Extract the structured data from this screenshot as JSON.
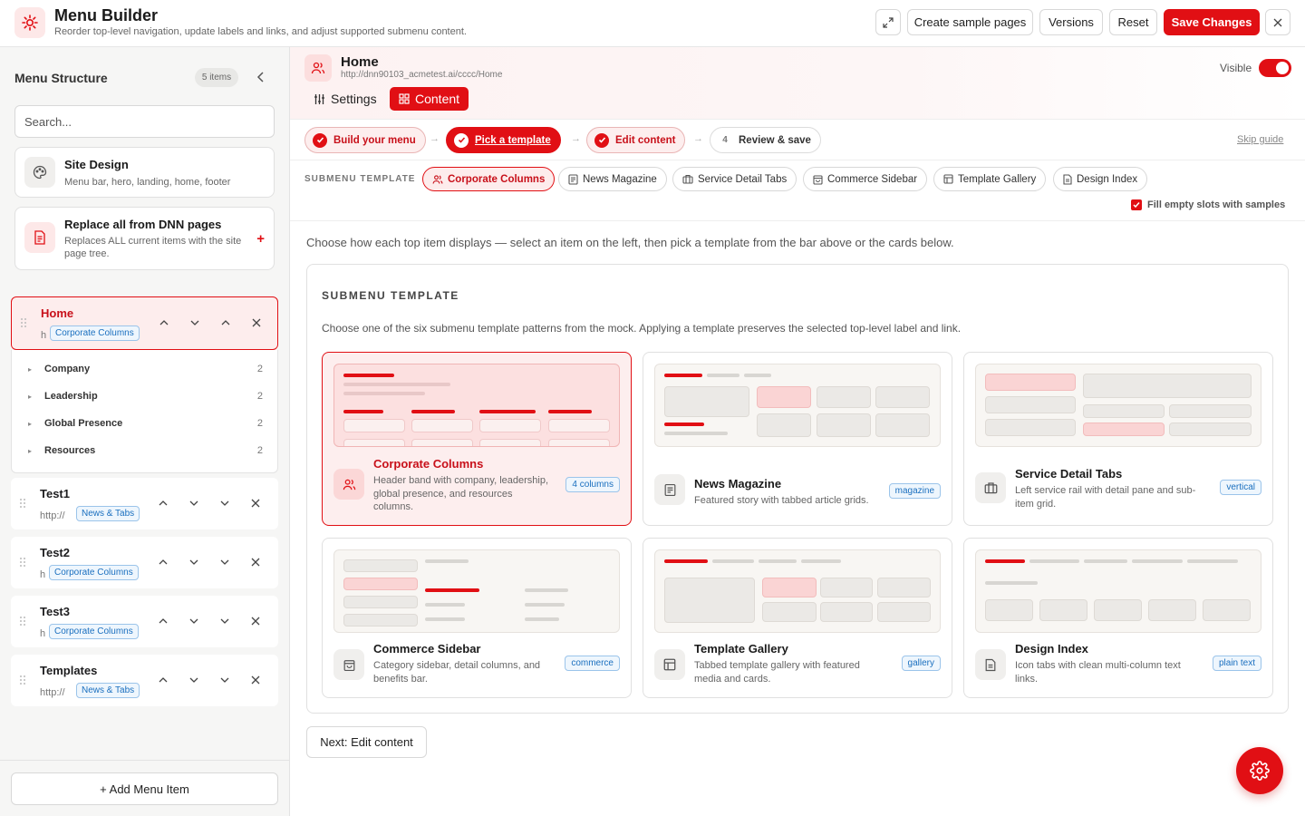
{
  "app": {
    "title": "Menu Builder",
    "subtitle": "Reorder top-level navigation, update labels and links, and adjust supported submenu content."
  },
  "toolbar": {
    "create_sample": "Create sample pages",
    "versions": "Versions",
    "reset": "Reset",
    "save": "Save Changes"
  },
  "sidebar": {
    "title": "Menu Structure",
    "count": "5 items",
    "search_placeholder": "Search...",
    "site_design": {
      "title": "Site Design",
      "desc": "Menu bar, hero, landing, home, footer"
    },
    "replace": {
      "title": "Replace all from DNN pages",
      "desc": "Replaces ALL current items with the site page tree."
    },
    "items": [
      {
        "title": "Home",
        "url": "http://dnn90103_acmetest.ai/cccc/Home",
        "template": "Corporate Columns"
      },
      {
        "title": "Test1",
        "url": "http://",
        "template": "News & Tabs"
      },
      {
        "title": "Test2",
        "url": "http://",
        "template": "Corporate Columns"
      },
      {
        "title": "Test3",
        "url": "http://",
        "template": "Corporate Columns"
      },
      {
        "title": "Templates",
        "url": "http://",
        "template": "News & Tabs"
      }
    ],
    "subitems": [
      {
        "label": "Company",
        "count": "2"
      },
      {
        "label": "Leadership",
        "count": "2"
      },
      {
        "label": "Global Presence",
        "count": "2"
      },
      {
        "label": "Resources",
        "count": "2"
      }
    ],
    "add_item": "+ Add Menu Item"
  },
  "page": {
    "title": "Home",
    "url": "http://dnn90103_acmetest.ai/cccc/Home",
    "visible_label": "Visible",
    "visible": true,
    "tabs": [
      "Settings",
      "Content"
    ],
    "active_tab": "Content"
  },
  "steps": [
    {
      "label": "Build your menu",
      "state": "done"
    },
    {
      "label": "Pick a template",
      "state": "current"
    },
    {
      "label": "Edit content",
      "state": "done"
    },
    {
      "num": "4",
      "label": "Review & save",
      "state": "todo"
    }
  ],
  "skip_guide": "Skip guide",
  "template_bar": {
    "label": "SUBMENU TEMPLATE",
    "chips": [
      "Corporate Columns",
      "News Magazine",
      "Service Detail Tabs",
      "Commerce Sidebar",
      "Template Gallery",
      "Design Index"
    ],
    "fill_label": "Fill empty slots with samples",
    "fill_checked": true
  },
  "intro": "Choose how each top item displays — select an item on the left, then pick a template from the bar above or the cards below.",
  "panel": {
    "title": "SUBMENU TEMPLATE",
    "subtitle": "Choose one of the six submenu template patterns from the mock. Applying a template preserves the selected top-level label and link."
  },
  "templates": [
    {
      "name": "Corporate Columns",
      "desc": "Header band with company, leadership, global presence, and resources columns.",
      "tag": "4 columns",
      "icon": "users-icon"
    },
    {
      "name": "News Magazine",
      "desc": "Featured story with tabbed article grids.",
      "tag": "magazine",
      "icon": "newspaper-icon"
    },
    {
      "name": "Service Detail Tabs",
      "desc": "Left service rail with detail pane and sub-item grid.",
      "tag": "vertical",
      "icon": "briefcase-icon"
    },
    {
      "name": "Commerce Sidebar",
      "desc": "Category sidebar, detail columns, and benefits bar.",
      "tag": "commerce",
      "icon": "shopping-bag-icon"
    },
    {
      "name": "Template Gallery",
      "desc": "Tabbed template gallery with featured media and cards.",
      "tag": "gallery",
      "icon": "layout-icon"
    },
    {
      "name": "Design Index",
      "desc": "Icon tabs with clean multi-column text links.",
      "tag": "plain text",
      "icon": "document-icon"
    }
  ],
  "next_button": "Next: Edit content",
  "colors": {
    "accent": "#e10f14",
    "accent_light": "#fdeeee",
    "badge_blue": "#1a6fbf"
  }
}
